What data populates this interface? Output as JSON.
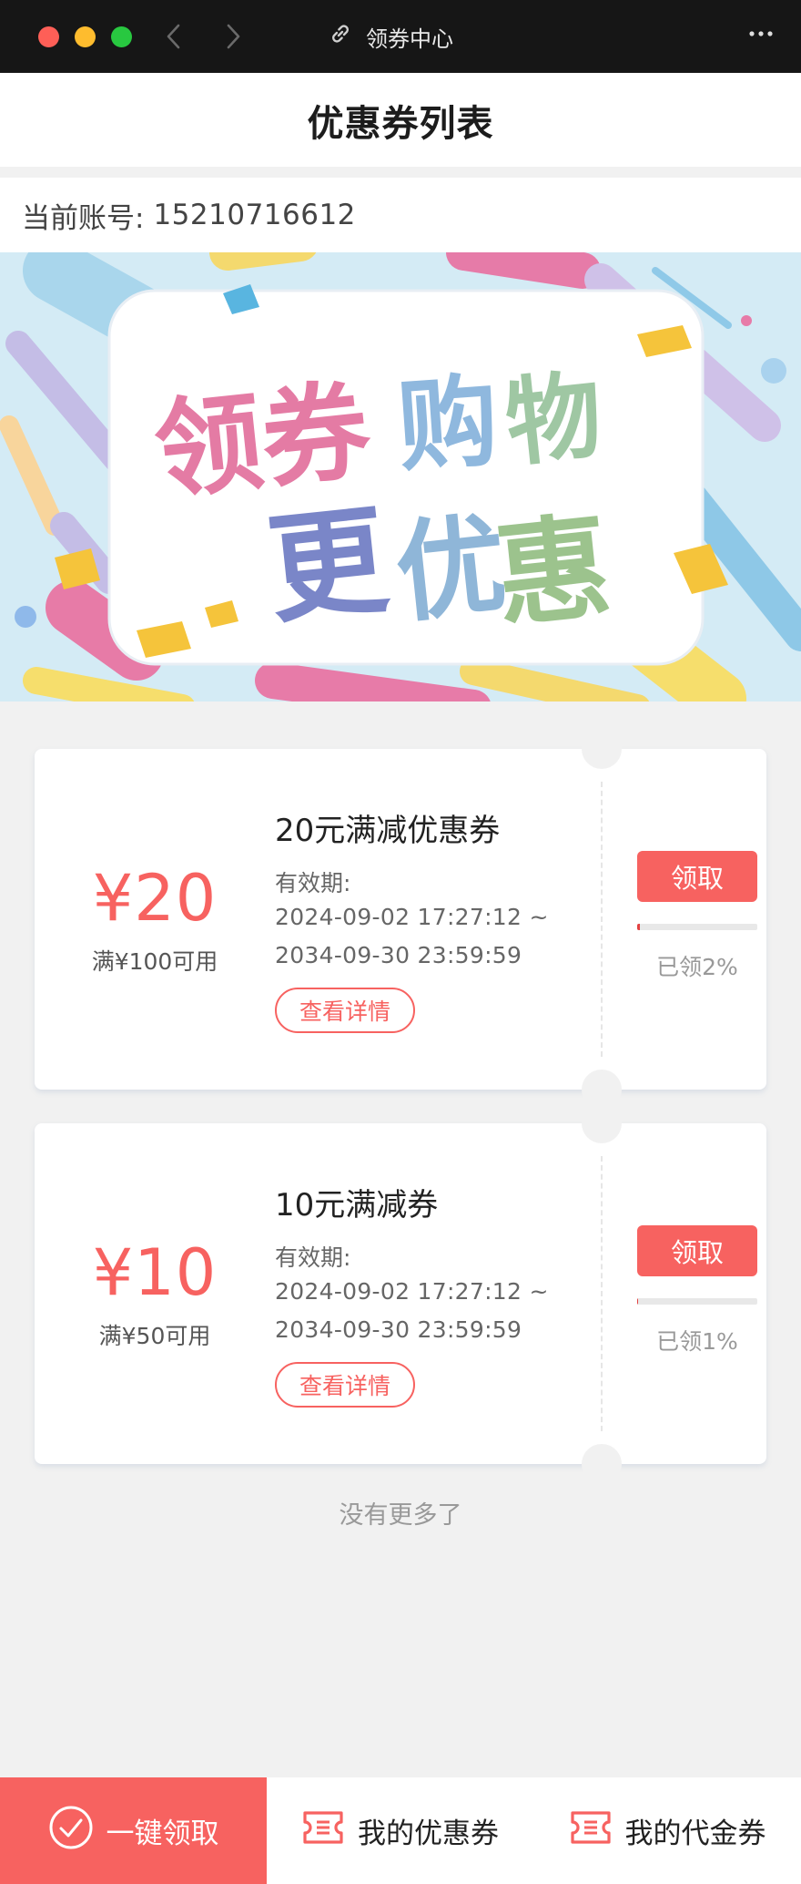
{
  "window": {
    "title": "领券中心",
    "icons": {
      "back": "chevron-left-icon",
      "forward": "chevron-right-icon",
      "link": "link-icon",
      "more": "more-horizontal-icon"
    }
  },
  "header": {
    "title": "优惠券列表"
  },
  "account": {
    "label": "当前账号:",
    "number": "15210716612"
  },
  "banner": {
    "alt_text": "领券购物更优惠"
  },
  "coupons": [
    {
      "amount": "¥20",
      "threshold": "满¥100可用",
      "name": "20元满减优惠券",
      "validity_label": "有效期:",
      "valid_from": "2024-09-02 17:27:12 ~",
      "valid_to": "2034-09-30 23:59:59",
      "detail_label": "查看详情",
      "claim_label": "领取",
      "claimed_percent": 2,
      "claimed_text": "已领2%"
    },
    {
      "amount": "¥10",
      "threshold": "满¥50可用",
      "name": "10元满减券",
      "validity_label": "有效期:",
      "valid_from": "2024-09-02 17:27:12 ~",
      "valid_to": "2034-09-30 23:59:59",
      "detail_label": "查看详情",
      "claim_label": "领取",
      "claimed_percent": 1,
      "claimed_text": "已领1%"
    }
  ],
  "footer_note": "没有更多了",
  "bottom_bar": {
    "claim_all": "一键领取",
    "my_coupons": "我的优惠券",
    "my_vouchers": "我的代金券"
  },
  "colors": {
    "accent": "#f76260",
    "titlebar": "#161616",
    "page_bg": "#f1f1f1"
  }
}
